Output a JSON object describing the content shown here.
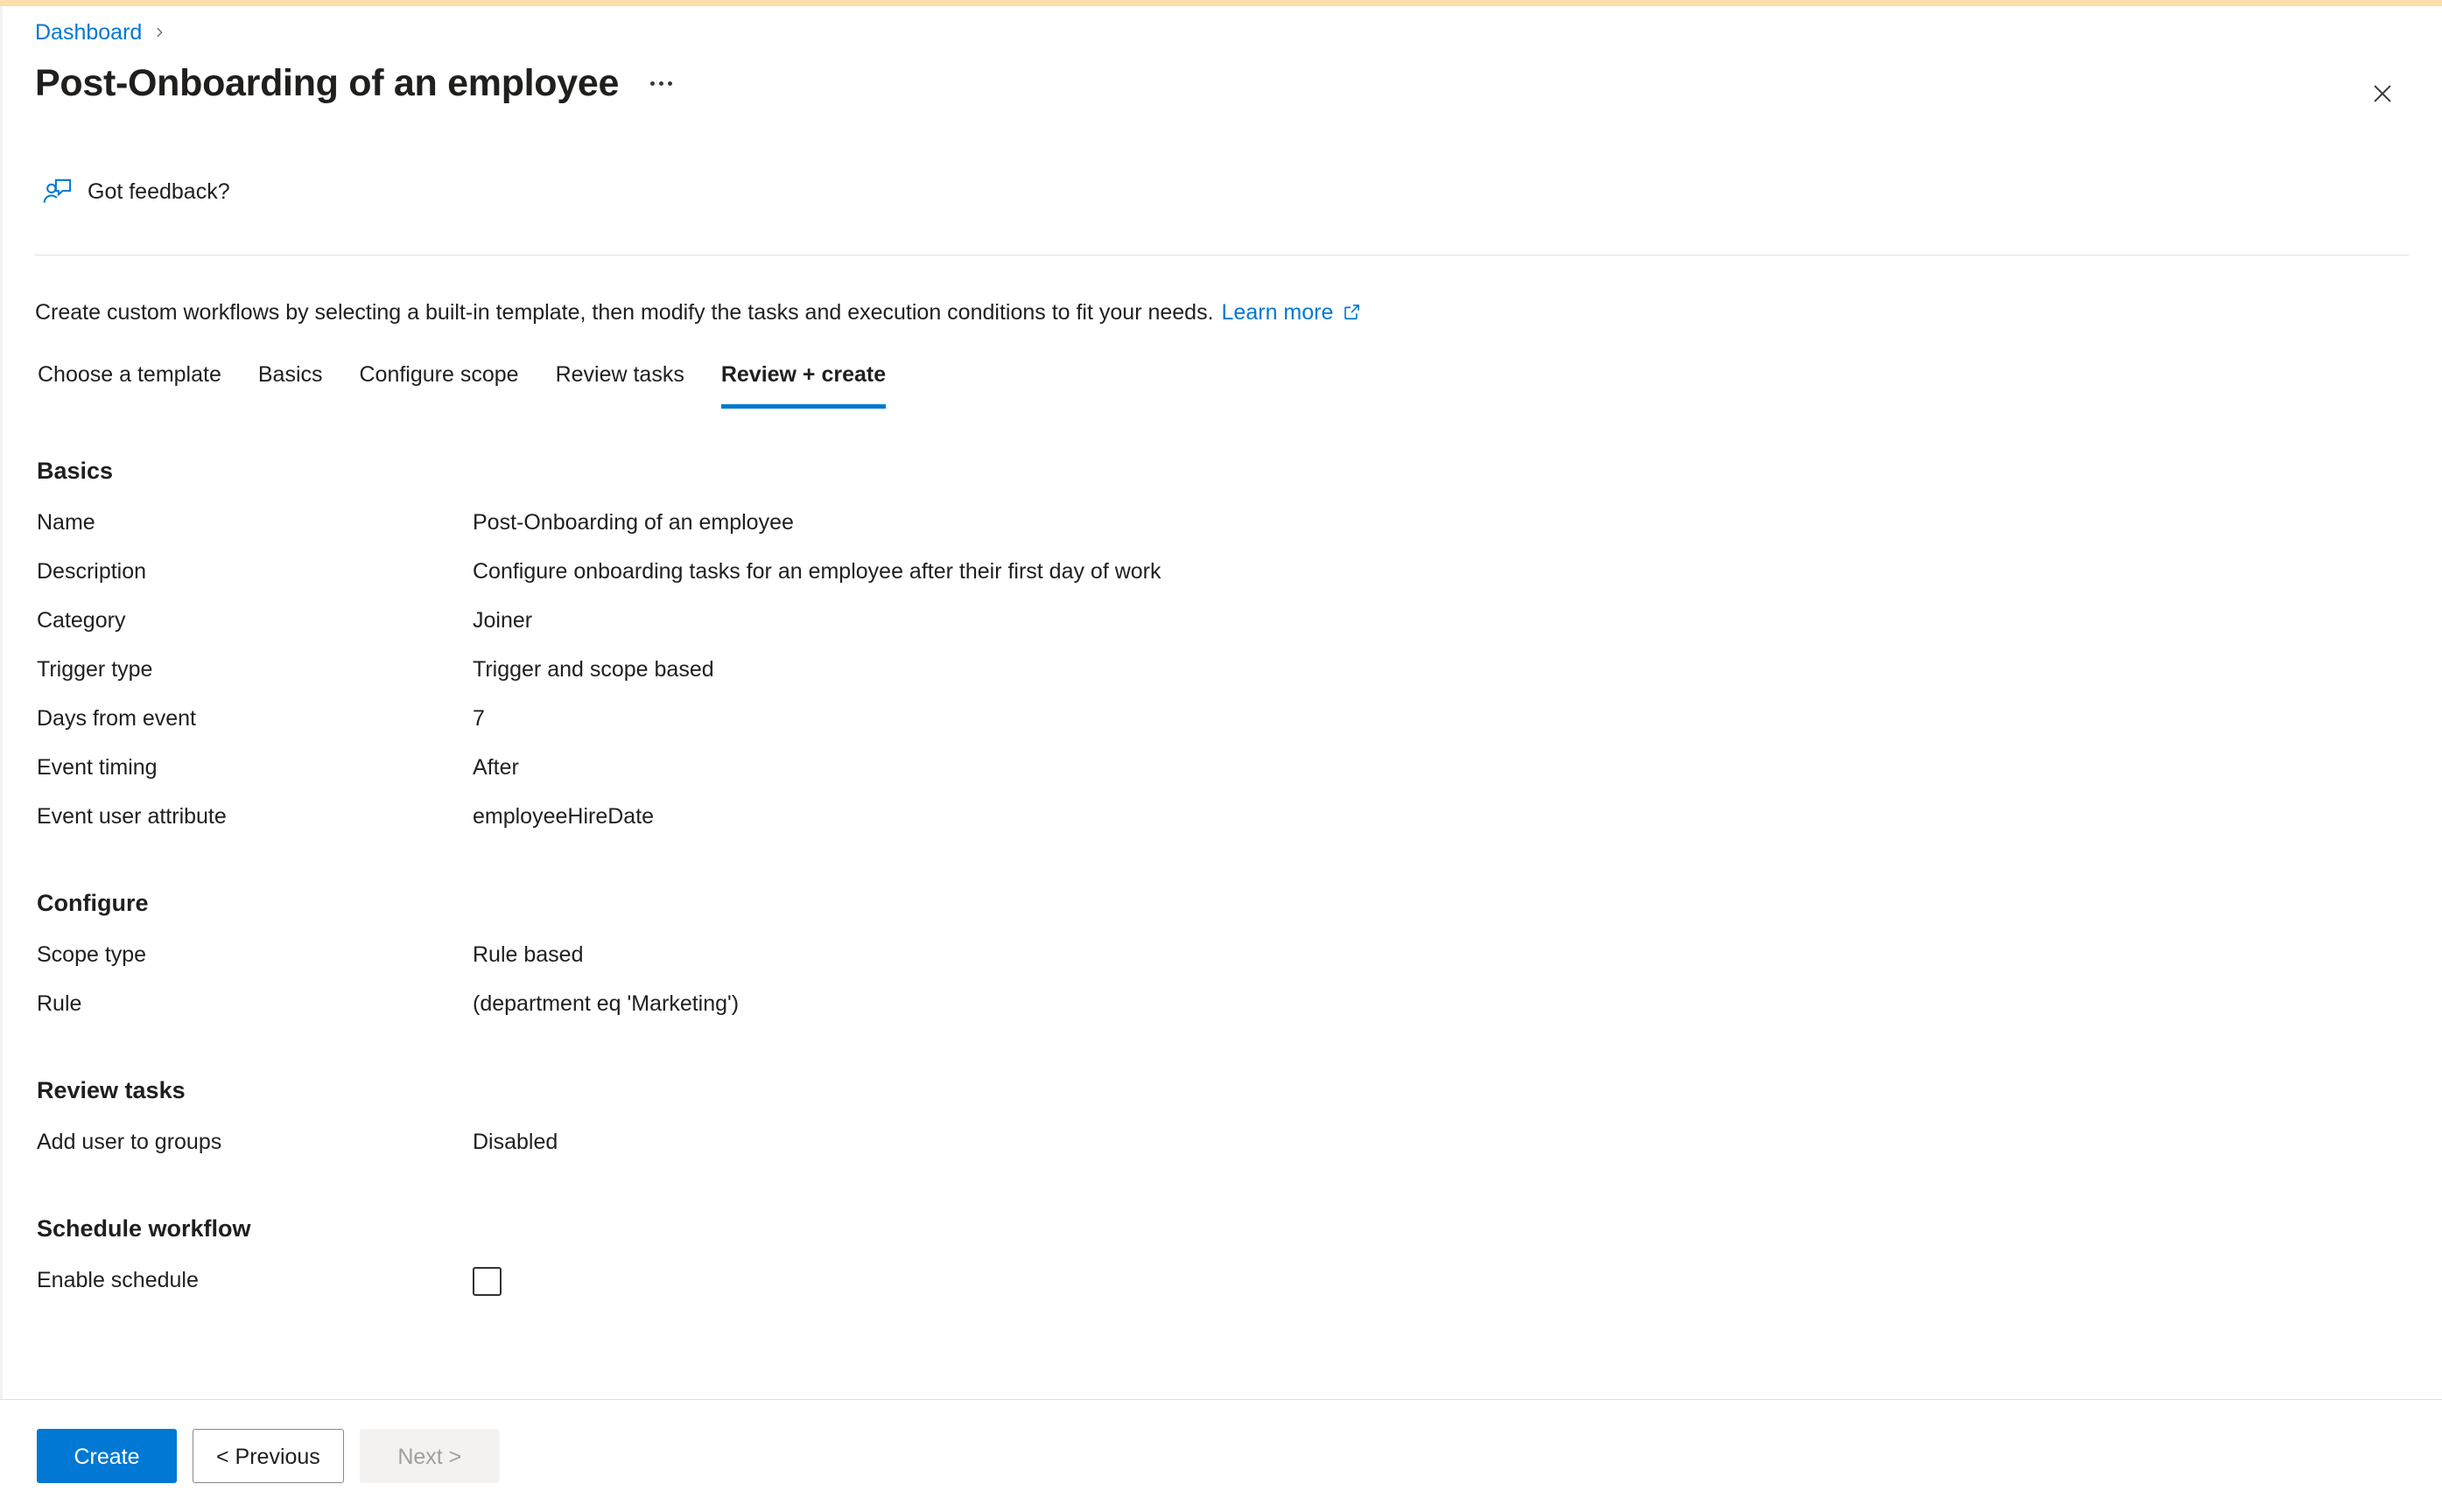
{
  "window": {
    "accent_color": "#fadeac",
    "brand_color": "#0078d4"
  },
  "header": {
    "breadcrumb": "Dashboard",
    "title": "Post-Onboarding of an employee",
    "more_menu_tooltip": "More",
    "close_tooltip": "Close",
    "feedback_label": "Got feedback?"
  },
  "intro": {
    "description": "Create custom workflows by selecting a built-in template, then modify the tasks and execution conditions to fit your needs.",
    "learn_more": "Learn more"
  },
  "tabs": [
    {
      "label": "Choose a template",
      "active": false
    },
    {
      "label": "Basics",
      "active": false
    },
    {
      "label": "Configure scope",
      "active": false
    },
    {
      "label": "Review tasks",
      "active": false
    },
    {
      "label": "Review + create",
      "active": true
    }
  ],
  "sections": [
    {
      "heading": "Basics",
      "rows": [
        {
          "key": "Name",
          "value": "Post-Onboarding of an employee"
        },
        {
          "key": "Description",
          "value": "Configure onboarding tasks for an employee after their first day of work"
        },
        {
          "key": "Category",
          "value": "Joiner"
        },
        {
          "key": "Trigger type",
          "value": "Trigger and scope based"
        },
        {
          "key": "Days from event",
          "value": "7"
        },
        {
          "key": "Event timing",
          "value": "After"
        },
        {
          "key": "Event user attribute",
          "value": "employeeHireDate"
        }
      ]
    },
    {
      "heading": "Configure",
      "rows": [
        {
          "key": "Scope type",
          "value": "Rule based"
        },
        {
          "key": "Rule",
          "value": "(department eq 'Marketing')"
        }
      ]
    },
    {
      "heading": "Review tasks",
      "rows": [
        {
          "key": "Add user to groups",
          "value": "Disabled"
        }
      ]
    },
    {
      "heading": "Schedule workflow",
      "rows": [
        {
          "key": "Enable schedule",
          "value": "",
          "control": "checkbox",
          "checked": false
        }
      ]
    }
  ],
  "footer": {
    "create_label": "Create",
    "previous_label": "< Previous",
    "next_label": "Next >",
    "next_disabled": true
  }
}
